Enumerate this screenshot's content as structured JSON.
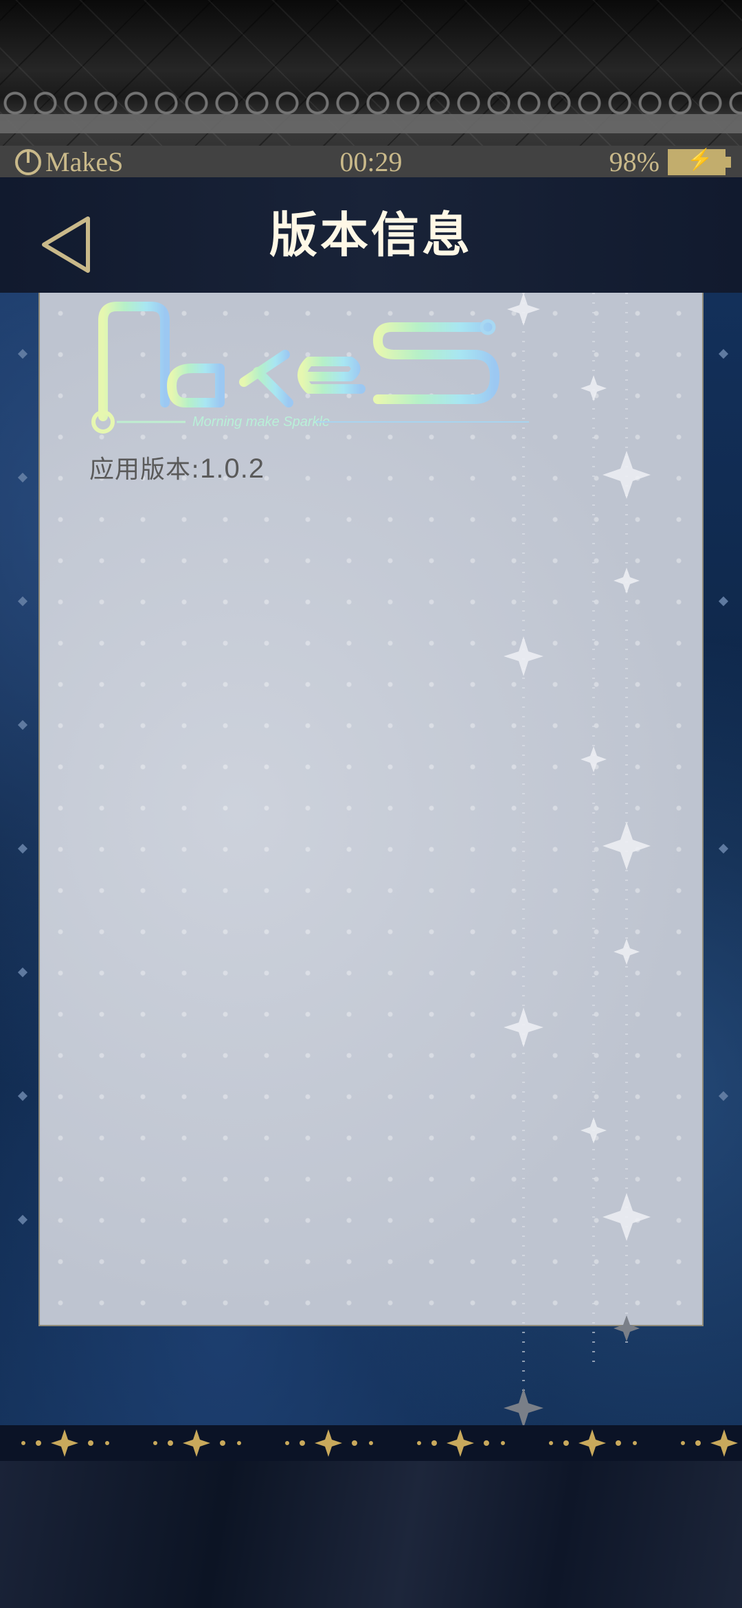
{
  "status_bar": {
    "brand": "MakeS",
    "time": "00:29",
    "battery": "98%"
  },
  "header": {
    "title": "版本信息"
  },
  "content": {
    "logo": {
      "wordmark": "MakeS",
      "tagline": "Morning make Sparkle"
    },
    "version_label": "应用版本:",
    "version_number": "1.0.2"
  },
  "colors": {
    "gold": "#c9b98a",
    "panel": "#c2c8d3",
    "header_bg": "#151e32",
    "title": "#fff8e6"
  },
  "icons": [
    "power-icon",
    "battery-charging-icon",
    "back-arrow-icon",
    "star-icon"
  ]
}
